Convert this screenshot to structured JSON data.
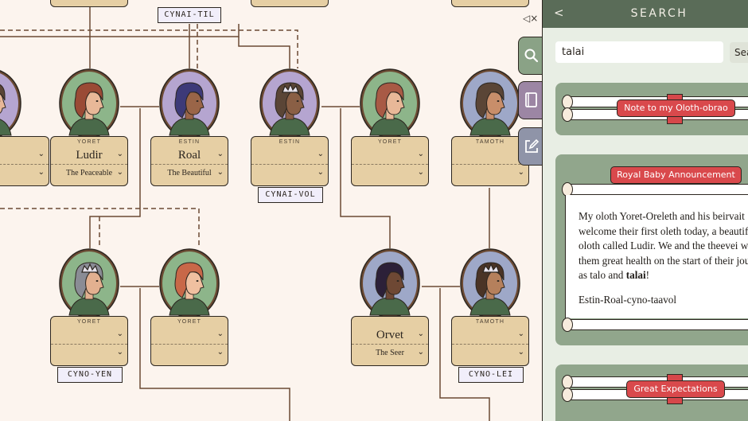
{
  "tree": {
    "mute_icon": "speaker-mute-icon",
    "top_tag": "CYNAI-TIL",
    "members": [
      {
        "house": "YORET",
        "name": "Ludir",
        "title": "The Peaceable",
        "bg": "#8db58a",
        "skin": "#e8b898",
        "hair": "#9a4a35",
        "crown": false,
        "tag": ""
      },
      {
        "house": "ESTIN",
        "name": "Roal",
        "title": "The Beautiful",
        "bg": "#b5a5d0",
        "skin": "#9a6548",
        "hair": "#3d3a78",
        "crown": false,
        "tag": ""
      },
      {
        "house": "ESTIN",
        "name": "",
        "title": "",
        "bg": "#b5a5d0",
        "skin": "#8a5f45",
        "hair": "#5a4536",
        "crown": true,
        "tag": "CYNAI-VOL"
      },
      {
        "house": "YORET",
        "name": "",
        "title": "",
        "bg": "#8db58a",
        "skin": "#e8b898",
        "hair": "#a85a45",
        "crown": false,
        "tag": ""
      },
      {
        "house": "TAMOTH",
        "name": "",
        "title": "",
        "bg": "#9ea8c8",
        "skin": "#c88e6a",
        "hair": "#5a4536",
        "crown": false,
        "tag": ""
      },
      {
        "house": "YORET",
        "name": "",
        "title": "",
        "bg": "#8db58a",
        "skin": "#e2b090",
        "hair": "#8a8c95",
        "crown": true,
        "tag": "CYNO-YEN"
      },
      {
        "house": "YORET",
        "name": "",
        "title": "",
        "bg": "#8db58a",
        "skin": "#f0c0a0",
        "hair": "#c86848",
        "crown": false,
        "tag": ""
      },
      {
        "house": "",
        "name": "Orvet",
        "title": "The Seer",
        "bg": "#9ea8c8",
        "skin": "#6e4834",
        "hair": "#2c2038",
        "crown": false,
        "tag": ""
      },
      {
        "house": "TAMOTH",
        "name": "",
        "title": "",
        "bg": "#9ea8c8",
        "skin": "#b5805c",
        "hair": "#4a3426",
        "crown": true,
        "tag": "CYNO-LEI"
      }
    ]
  },
  "tabs": [
    {
      "name": "search",
      "icon": "magnifier-icon",
      "color": "#8aa286"
    },
    {
      "name": "journal",
      "icon": "book-icon",
      "color": "#9c86a4"
    },
    {
      "name": "edit",
      "icon": "pencil-square-icon",
      "color": "#8f94a8"
    }
  ],
  "panel": {
    "back_label": "<",
    "title": "SEARCH",
    "search_value": "talai",
    "search_button": "Search",
    "results": [
      {
        "label": "Note to my Oloth-obrao"
      },
      {
        "label": "Royal Baby Announcement",
        "lines": [
          "My oloth Yoret-Oreleth and his beirvait",
          "welcome their first oleth today, a beautiful",
          "oloth called Ludir. We and the theevei wi",
          "them great health on the start of their jou"
        ],
        "last_line_prefix": "as talo and ",
        "highlight": "talai",
        "last_line_suffix": "!",
        "signature": "Estin-Roal-cyno-taavol"
      },
      {
        "label": "Great Expectations"
      }
    ]
  }
}
